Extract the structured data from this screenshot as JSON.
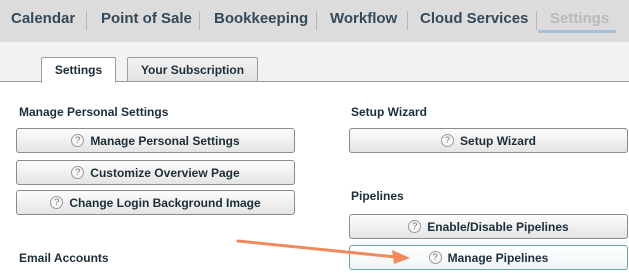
{
  "topnav": {
    "items": [
      "Calendar",
      "Point of Sale",
      "Bookkeeping",
      "Workflow",
      "Cloud Services",
      "Settings"
    ]
  },
  "tabs": {
    "settings": "Settings",
    "subscription": "Your Subscription"
  },
  "left": {
    "personal_heading": "Manage Personal Settings",
    "buttons": [
      "Manage Personal Settings",
      "Customize Overview Page",
      "Change Login Background Image"
    ],
    "email_heading": "Email Accounts"
  },
  "right": {
    "wizard_heading": "Setup Wizard",
    "wizard_button": "Setup Wizard",
    "pipelines_heading": "Pipelines",
    "pipelines_buttons": [
      "Enable/Disable Pipelines",
      "Manage Pipelines"
    ]
  },
  "help_icon_glyph": "?",
  "colors": {
    "nav_bg": "#dcdcdc",
    "active_underline": "#a9bfd6",
    "annotation_arrow": "#f08a5d",
    "highlight_border": "#6aa6a9"
  }
}
